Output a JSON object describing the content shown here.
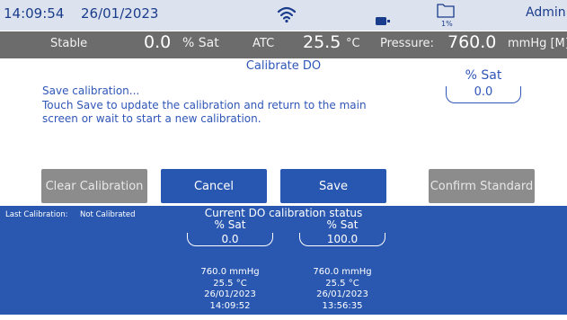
{
  "status_bar": {
    "time": "14:09:54",
    "date": "26/01/2023",
    "storage_percent": "1%",
    "user": "Admin",
    "wifi_icon": "wifi-icon",
    "battery_icon": "battery-icon",
    "folder_icon": "folder-icon"
  },
  "reading_bar": {
    "stability": "Stable",
    "do_value": "0.0",
    "do_unit": "% Sat",
    "atc_label": "ATC",
    "temp_value": "25.5",
    "temp_unit": "°C",
    "pressure_label": "Pressure:",
    "pressure_value": "760.0",
    "pressure_unit": "mmHg [M]"
  },
  "main": {
    "title": "Calibrate DO",
    "message_line1": "Save calibration...",
    "message_line2": "Touch Save to update the calibration and return to the main",
    "message_line3": "screen or wait to start a new calibration.",
    "current_unit": "% Sat",
    "current_value": "0.0"
  },
  "buttons": {
    "clear": "Clear Calibration",
    "cancel": "Cancel",
    "save": "Save",
    "confirm": "Confirm Standard"
  },
  "status_panel": {
    "last_calibration_label": "Last Calibration:",
    "last_calibration_value": "Not Calibrated",
    "heading": "Current DO calibration status",
    "points": [
      {
        "unit": "% Sat",
        "value": "0.0",
        "pressure": "760.0 mmHg",
        "temp": "25.5 °C",
        "date": "26/01/2023",
        "time": "14:09:52"
      },
      {
        "unit": "% Sat",
        "value": "100.0",
        "pressure": "760.0 mmHg",
        "temp": "25.5 °C",
        "date": "26/01/2023",
        "time": "13:56:35"
      }
    ]
  },
  "colors": {
    "accent_blue": "#2757b0",
    "disabled_gray": "#8c8c8c",
    "status_bar_bg": "#dde3ee",
    "reading_bar_bg": "#6c6c6c"
  }
}
